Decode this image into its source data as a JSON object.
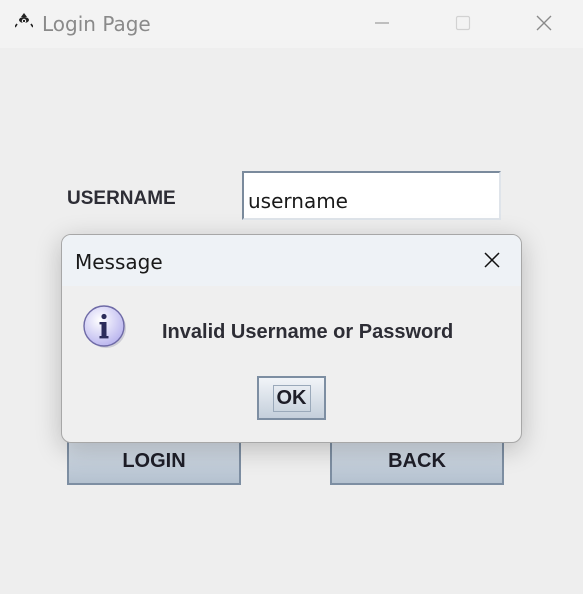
{
  "window": {
    "title": "Login Page",
    "icon": "duke-java-icon",
    "controls": [
      "minimize-icon",
      "maximize-icon",
      "close-icon"
    ]
  },
  "form": {
    "username_label": "USERNAME",
    "username_value": "username",
    "login_label": "LOGIN",
    "back_label": "BACK"
  },
  "dialog": {
    "title": "Message",
    "icon": "info-icon",
    "message": "Invalid Username or Password",
    "ok_label": "OK"
  },
  "colors": {
    "button_border": "#7d8ea2",
    "info_icon_fill": "#c9c6f2",
    "label_text": "#2d2d35"
  }
}
